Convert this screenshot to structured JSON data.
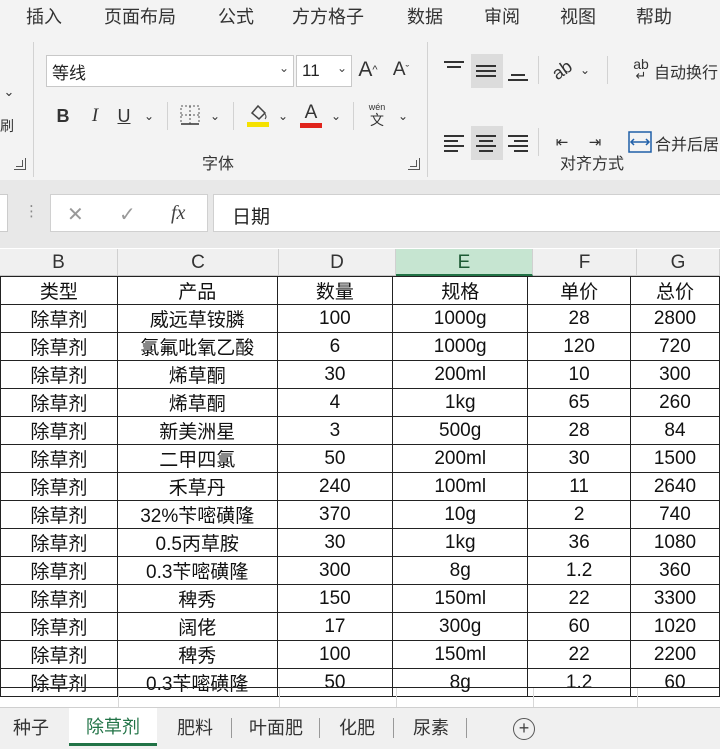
{
  "menu": [
    "插入",
    "页面布局",
    "公式",
    "方方格子",
    "数据",
    "审阅",
    "视图",
    "帮助"
  ],
  "ribbon": {
    "font_name": "等线",
    "font_size": "11",
    "grow_font": "A",
    "shrink_font": "A",
    "bold": "B",
    "italic": "I",
    "underline": "U",
    "font_color_letter": "A",
    "phonetic_top": "wén",
    "phonetic_bottom": "文",
    "wrap_text": "自动换行",
    "merge_center": "合并后居",
    "wrap_icon": "ab",
    "font_group_label": "字体",
    "align_group_label": "对齐方式",
    "left_partial": "刷",
    "highlight_color": "#f5e100",
    "font_color": "#e0231b"
  },
  "formula_bar": {
    "cancel": "✕",
    "enter": "✓",
    "fx": "fx",
    "value": "日期"
  },
  "columns": [
    "B",
    "C",
    "D",
    "E",
    "F",
    "G"
  ],
  "active_column": "E",
  "table": {
    "headers": [
      "类型",
      "产品",
      "数量",
      "规格",
      "单价",
      "总价"
    ],
    "rows": [
      [
        "除草剂",
        "威远草铵膦",
        "100",
        "1000g",
        "28",
        "2800"
      ],
      [
        "除草剂",
        "氯氟吡氧乙酸",
        "6",
        "1000g",
        "120",
        "720"
      ],
      [
        "除草剂",
        "烯草酮",
        "30",
        "200ml",
        "10",
        "300"
      ],
      [
        "除草剂",
        "烯草酮",
        "4",
        "1kg",
        "65",
        "260"
      ],
      [
        "除草剂",
        "新美洲星",
        "3",
        "500g",
        "28",
        "84"
      ],
      [
        "除草剂",
        "二甲四氯",
        "50",
        "200ml",
        "30",
        "1500"
      ],
      [
        "除草剂",
        "禾草丹",
        "240",
        "100ml",
        "11",
        "2640"
      ],
      [
        "除草剂",
        "32%苄嘧磺隆",
        "370",
        "10g",
        "2",
        "740"
      ],
      [
        "除草剂",
        "0.5丙草胺",
        "30",
        "1kg",
        "36",
        "1080"
      ],
      [
        "除草剂",
        "0.3苄嘧磺隆",
        "300",
        "8g",
        "1.2",
        "360"
      ],
      [
        "除草剂",
        "稗秀",
        "150",
        "150ml",
        "22",
        "3300"
      ],
      [
        "除草剂",
        "阔佬",
        "17",
        "300g",
        "60",
        "1020"
      ],
      [
        "除草剂",
        "稗秀",
        "100",
        "150ml",
        "22",
        "2200"
      ],
      [
        "除草剂",
        "0.3苄嘧磺隆",
        "50",
        "8g",
        "1.2",
        "60"
      ]
    ]
  },
  "sheets": [
    "种子",
    "除草剂",
    "肥料",
    "叶面肥",
    "化肥",
    "尿素"
  ],
  "active_sheet": "除草剂",
  "add_sheet": "+"
}
